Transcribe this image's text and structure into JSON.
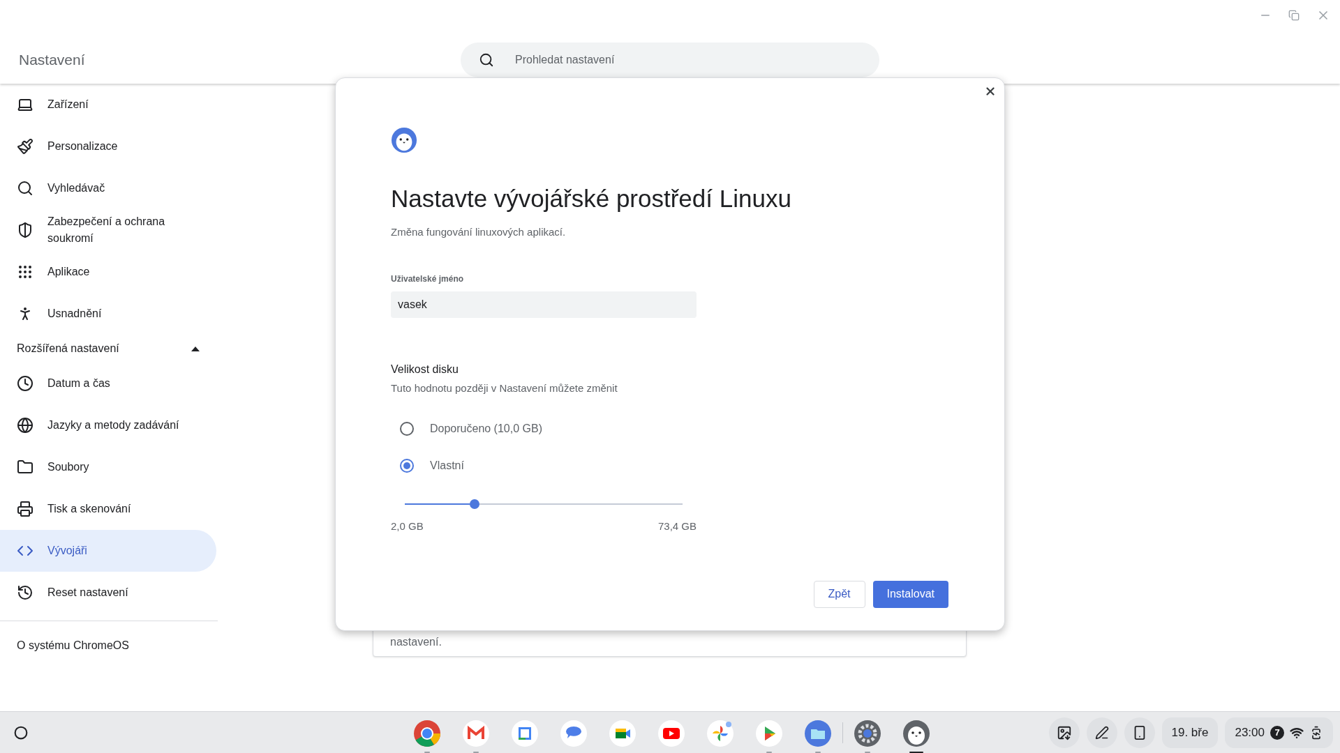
{
  "window": {
    "title": "Nastavení"
  },
  "search": {
    "placeholder": "Prohledat nastavení"
  },
  "sidebar": {
    "items": [
      {
        "label": "Zařízení",
        "selected": false
      },
      {
        "label": "Personalizace",
        "selected": false
      },
      {
        "label": "Vyhledávač",
        "selected": false
      },
      {
        "label": "Zabezpečení a ochrana soukromí",
        "selected": false
      },
      {
        "label": "Aplikace",
        "selected": false
      },
      {
        "label": "Usnadnění",
        "selected": false
      }
    ],
    "advanced": {
      "label": "Rozšířená nastavení",
      "expanded": true,
      "items": [
        {
          "label": "Datum a čas",
          "selected": false
        },
        {
          "label": "Jazyky a metody zadávání",
          "selected": false
        },
        {
          "label": "Soubory",
          "selected": false
        },
        {
          "label": "Tisk a skenování",
          "selected": false
        },
        {
          "label": "Vývojáři",
          "selected": true
        },
        {
          "label": "Reset nastavení",
          "selected": false
        }
      ]
    },
    "about": "O systému ChromeOS"
  },
  "background_card": {
    "text": "nastavení."
  },
  "dialog": {
    "title": "Nastavte vývojářské prostředí Linuxu",
    "subtitle": "Změna fungování linuxových aplikací.",
    "username": {
      "label": "Uživatelské jméno",
      "value": "vasek"
    },
    "disk": {
      "title": "Velikost disku",
      "hint": "Tuto hodnotu později v Nastavení můžete změnit",
      "options": [
        {
          "label": "Doporučeno (10,0 GB)",
          "selected": false
        },
        {
          "label": "Vlastní",
          "selected": true
        }
      ],
      "slider": {
        "level": 0.25,
        "min_label": "2,0 GB",
        "max_label": "73,4 GB"
      }
    },
    "buttons": [
      {
        "label": "Zpět",
        "kind": "secondary"
      },
      {
        "label": "Instalovat",
        "kind": "primary"
      }
    ]
  },
  "taskbar": {
    "apps": [
      {
        "running": true,
        "selected": false
      },
      {
        "running": true,
        "selected": false
      },
      {
        "running": false,
        "selected": false
      },
      {
        "running": false,
        "selected": false
      },
      {
        "running": false,
        "selected": false
      },
      {
        "running": false,
        "selected": false
      },
      {
        "running": false,
        "selected": false
      },
      {
        "running": true,
        "selected": false
      },
      {
        "running": true,
        "selected": false
      },
      {
        "running": true,
        "selected": false
      },
      {
        "running": true,
        "selected": true
      }
    ],
    "date": "19. bře",
    "time": "23:00",
    "notifications": "7"
  }
}
